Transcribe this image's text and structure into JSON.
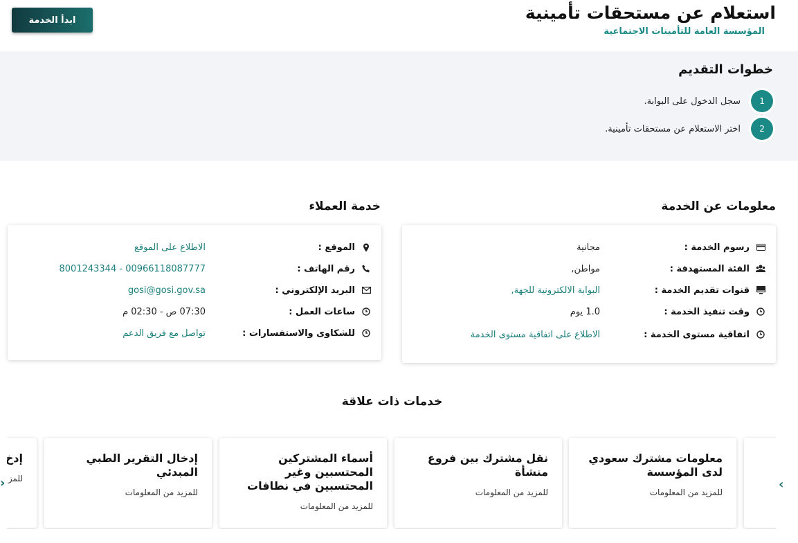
{
  "header": {
    "title": "استعلام عن مستحقات تأمينية",
    "subtitle": "المؤسسة العامة للتأمينات الاجتماعية",
    "start_button": "ابدأ الخدمة"
  },
  "steps": {
    "title": "خطوات التقديم",
    "items": [
      {
        "num": "1",
        "text": "سجل الدخول على البوابة."
      },
      {
        "num": "2",
        "text": "اختر الاستعلام عن مستحقات تأمينية."
      }
    ]
  },
  "service_info": {
    "title": "معلومات عن الخدمة",
    "rows": [
      {
        "icon": "credit-card-icon",
        "label": "رسوم الخدمة :",
        "value": "مجانية"
      },
      {
        "icon": "users-icon",
        "label": "الفئة المستهدفة :",
        "value": "مواطن,"
      },
      {
        "icon": "monitor-icon",
        "label": "قنوات تقديم الخدمة :",
        "value": "البوابة الالكترونية للجهة,"
      },
      {
        "icon": "clock-icon",
        "label": "وقت تنفيذ الخدمة :",
        "value": "1.0 يوم"
      },
      {
        "icon": "clock-icon",
        "label": "اتفاقية مستوى الخدمة :",
        "value": "الاطلاع على اتفاقية مستوى الخدمة"
      }
    ]
  },
  "customer_service": {
    "title": "خدمة العملاء",
    "rows": [
      {
        "icon": "location-pin-icon",
        "label": "الموقع :",
        "value": "الاطلاع على الموقع"
      },
      {
        "icon": "phone-icon",
        "label": "رقم الهاتف :",
        "value": "00966118087777 - 8001243344"
      },
      {
        "icon": "envelope-icon",
        "label": "البريد الإلكتروني :",
        "value": "gosi@gosi.gov.sa"
      },
      {
        "icon": "clock-icon",
        "label": "ساعات العمل :",
        "value": "07:30 ص - 02:30 م"
      },
      {
        "icon": "clock-icon",
        "label": "للشكاوى والاستفسارات :",
        "value": "تواصل مع فريق الدعم"
      }
    ]
  },
  "related": {
    "title": "خدمات ذات علاقة",
    "cards": [
      {
        "title": "معلومات مشترك سعودي لدى المؤسسة",
        "more": "للمزيد من المعلومات"
      },
      {
        "title": "نقل مشترك بين فروع منشأة",
        "more": "للمزيد من المعلومات"
      },
      {
        "title": "أسماء المشتركين المحتسبين وغير المحتسبين في نطاقات",
        "more": "للمزيد من المعلومات"
      },
      {
        "title": "إدخال التقرير الطبي المبدئي",
        "more": "للمزيد من المعلومات"
      },
      {
        "title": "إدخ",
        "more": "للمز"
      }
    ],
    "next_arrow": "›",
    "prev_arrow": "‹"
  }
}
